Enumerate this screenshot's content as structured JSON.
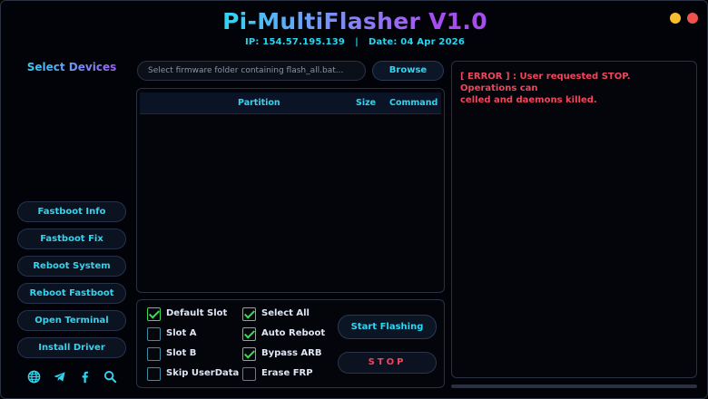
{
  "header": {
    "title_main": "Pi-MultiFlasher",
    "title_version": "V1.0",
    "ip_label": "IP:",
    "ip_value": "154.57.195.139",
    "separator": "|",
    "date_label": "Date:",
    "date_value": "04 Apr 2026"
  },
  "sidebar": {
    "select_devices": "Select Devices",
    "buttons": [
      {
        "label": "Fastboot Info"
      },
      {
        "label": "Fastboot Fix"
      },
      {
        "label": "Reboot System"
      },
      {
        "label": "Reboot Fastboot"
      },
      {
        "label": "Open Terminal"
      },
      {
        "label": "Install Driver"
      }
    ],
    "social_icons": [
      "globe-icon",
      "telegram-icon",
      "facebook-icon",
      "search-icon"
    ]
  },
  "firmware": {
    "placeholder": "Select firmware folder containing flash_all.bat...",
    "browse_label": "Browse"
  },
  "partition_table": {
    "columns": {
      "partition": "Partition",
      "size": "Size",
      "command": "Command"
    },
    "rows": []
  },
  "options": {
    "default_slot": {
      "label": "Default Slot",
      "checked": true
    },
    "slot_a": {
      "label": "Slot A",
      "checked": false
    },
    "slot_b": {
      "label": "Slot B",
      "checked": false
    },
    "skip_userdata": {
      "label": "Skip UserData",
      "checked": false
    },
    "select_all": {
      "label": "Select All",
      "checked": true
    },
    "auto_reboot": {
      "label": "Auto Reboot",
      "checked": true
    },
    "bypass_arb": {
      "label": "Bypass ARB",
      "checked": true
    },
    "erase_frp": {
      "label": "Erase FRP",
      "checked": false
    }
  },
  "actions": {
    "start_label": "Start Flashing",
    "stop_label": "STOP"
  },
  "log": {
    "line1": "[ ERROR ] : User requested STOP. Operations can",
    "line2": "celled and daemons killed."
  },
  "colors": {
    "accent_cyan": "#2fd6f2",
    "accent_purple": "#a64df0",
    "error_red": "#f0465d",
    "check_green": "#3fdc55",
    "window_min": "#f7bd2e",
    "window_close": "#f0524f"
  }
}
